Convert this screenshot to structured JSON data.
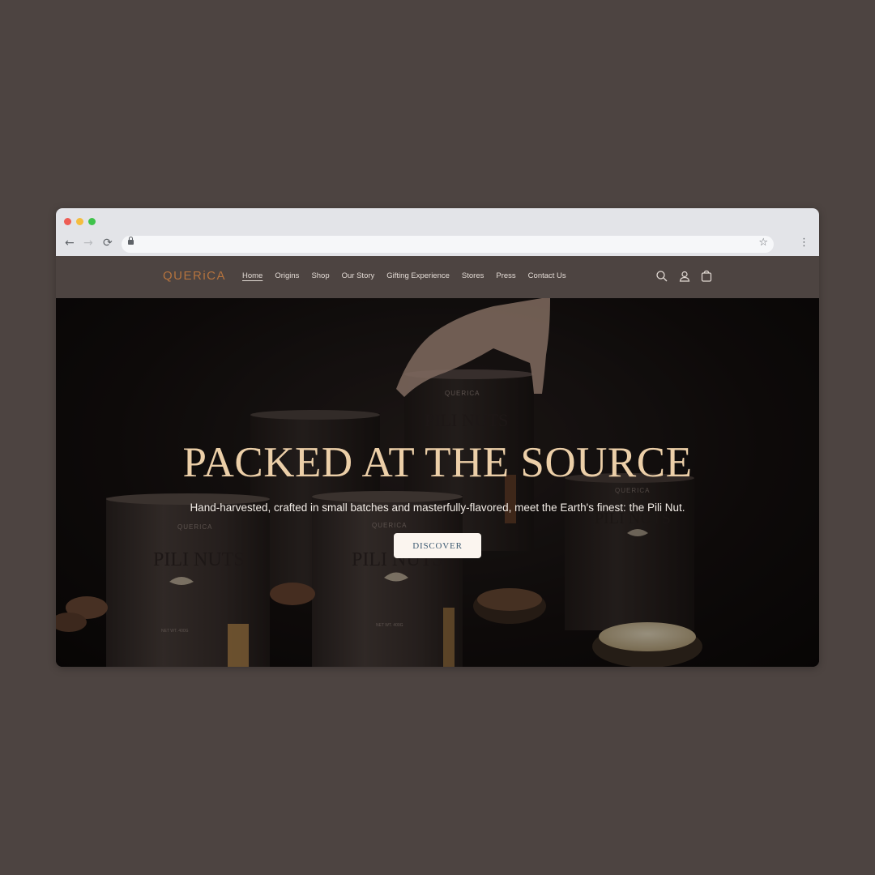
{
  "browser": {
    "url": ""
  },
  "site": {
    "logo": "QUERiCA",
    "nav": [
      {
        "label": "Home",
        "active": true
      },
      {
        "label": "Origins"
      },
      {
        "label": "Shop"
      },
      {
        "label": "Our Story"
      },
      {
        "label": "Gifting Experience"
      },
      {
        "label": "Stores"
      },
      {
        "label": "Press"
      },
      {
        "label": "Contact Us"
      }
    ],
    "icons": [
      "search-icon",
      "account-icon",
      "cart-icon"
    ]
  },
  "hero": {
    "title": "PACKED AT THE SOURCE",
    "subtitle": "Hand-harvested, crafted in small batches and masterfully-flavored, meet the Earth's finest: the Pili Nut.",
    "cta": "DISCOVER",
    "can_brand": "QUERICA",
    "can_product": "PILI NUTS",
    "can_weight": "NET WT. 400G"
  },
  "colors": {
    "page_bg": "#4d4441",
    "header_bg": "#4d4441",
    "logo": "#b5733e",
    "title": "#eccfa8",
    "cta_bg": "#fbf5ef",
    "cta_text": "#3c5a72"
  }
}
